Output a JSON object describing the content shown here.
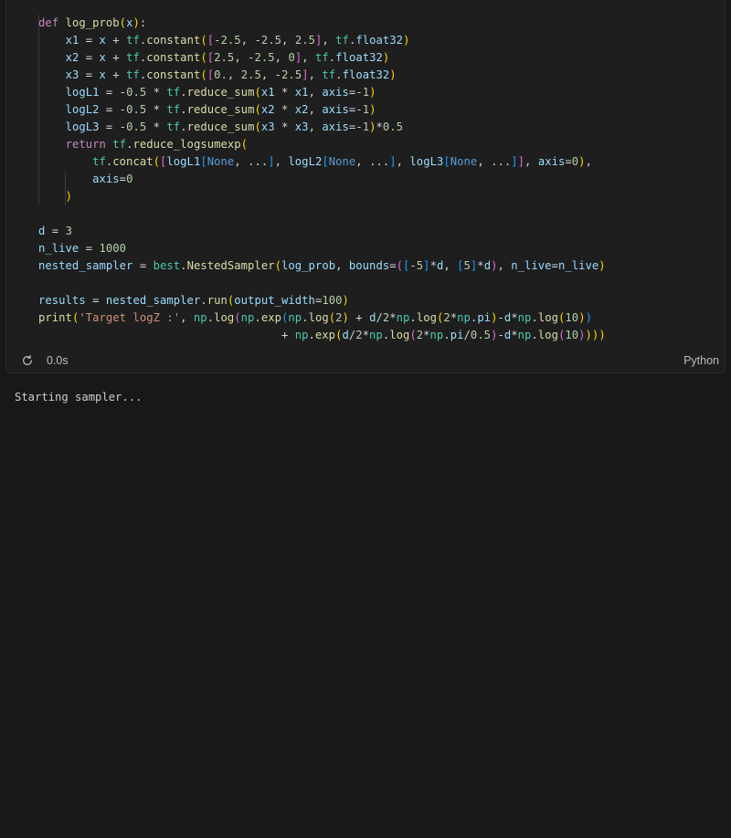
{
  "cell": {
    "code_lines": [
      "def log_prob(x):",
      "    x1 = x + tf.constant([-2.5, -2.5, 2.5], tf.float32)",
      "    x2 = x + tf.constant([2.5, -2.5, 0], tf.float32)",
      "    x3 = x + tf.constant([0., 2.5, -2.5], tf.float32)",
      "    logL1 = -0.5 * tf.reduce_sum(x1 * x1, axis=-1)",
      "    logL2 = -0.5 * tf.reduce_sum(x2 * x2, axis=-1)",
      "    logL3 = -0.5 * tf.reduce_sum(x3 * x3, axis=-1)*0.5",
      "    return tf.reduce_logsumexp(",
      "        tf.concat([logL1[None, ...], logL2[None, ...], logL3[None, ...]], axis=0),",
      "        axis=0",
      "    )",
      "",
      "d = 3",
      "n_live = 1000",
      "nested_sampler = best.NestedSampler(log_prob, bounds=([-5]*d, [5]*d), n_live=n_live)",
      "",
      "results = nested_sampler.run(output_width=100)",
      "print('Target logZ :', np.log(np.exp(np.log(2) + d/2*np.log(2*np.pi)-d*np.log(10))",
      "                                    + np.exp(d/2*np.log(2*np.pi/0.5)-d*np.log(10))))"
    ],
    "execution_time": "0.0s",
    "language": "Python"
  },
  "output": {
    "text": "Starting sampler..."
  },
  "colors": {
    "background": "#181818",
    "cell_background": "#1e1e1e",
    "keyword": "#c586c0",
    "function": "#dcdcaa",
    "module": "#4ec9b0",
    "variable": "#9cdcfe",
    "number": "#b5cea8",
    "string": "#ce9178"
  }
}
